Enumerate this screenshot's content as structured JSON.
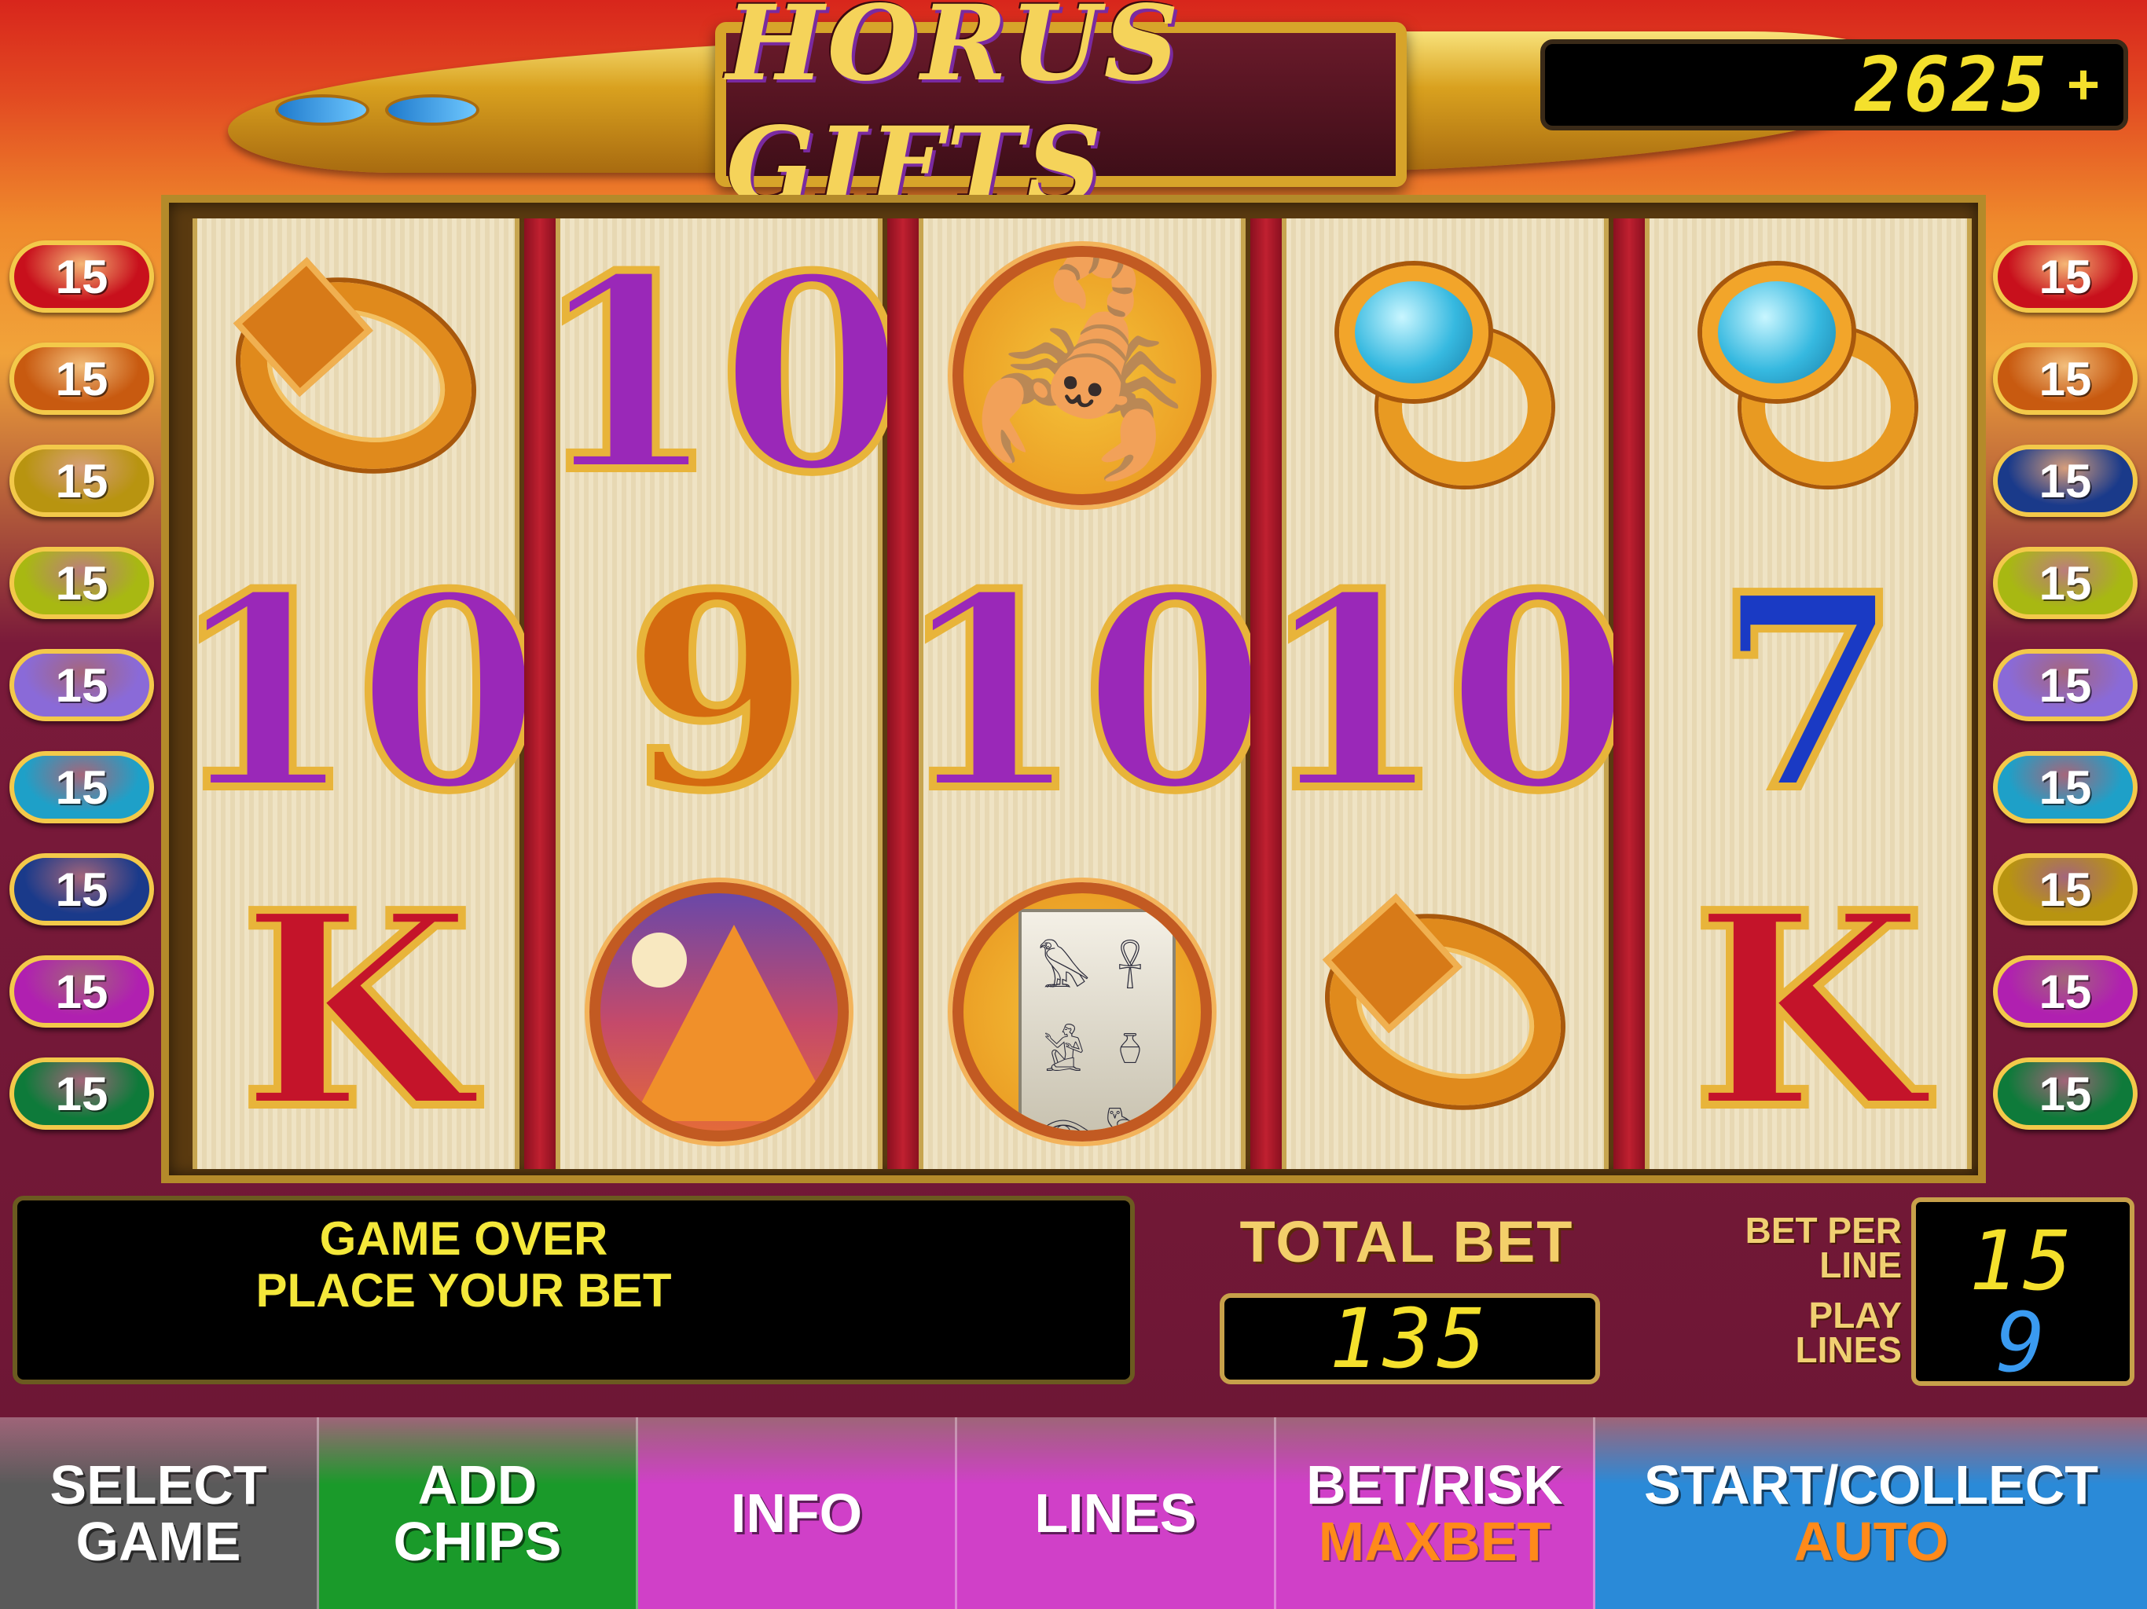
{
  "game": {
    "title": "HORUS GIFTS",
    "credits": "2625",
    "credits_add": "+"
  },
  "reels": [
    [
      "gold-ring",
      "10",
      "K"
    ],
    [
      "10",
      "9",
      "pyramid"
    ],
    [
      "scorpion",
      "10",
      "hieroglyph-tablet"
    ],
    [
      "gem-ring",
      "10",
      "gold-ring"
    ],
    [
      "gem-ring",
      "7",
      "K"
    ]
  ],
  "lines_left": [
    {
      "value": "15",
      "color": "#c8101c"
    },
    {
      "value": "15",
      "color": "#c85a10"
    },
    {
      "value": "15",
      "color": "#b89410"
    },
    {
      "value": "15",
      "color": "#a8b812"
    },
    {
      "value": "15",
      "color": "#8a6ad8"
    },
    {
      "value": "15",
      "color": "#1ea0c8"
    },
    {
      "value": "15",
      "color": "#1a3a8a"
    },
    {
      "value": "15",
      "color": "#b020b0"
    },
    {
      "value": "15",
      "color": "#0e7a3a"
    }
  ],
  "lines_right": [
    {
      "value": "15",
      "color": "#c8101c"
    },
    {
      "value": "15",
      "color": "#c85a10"
    },
    {
      "value": "15",
      "color": "#1a3a8a"
    },
    {
      "value": "15",
      "color": "#a8b812"
    },
    {
      "value": "15",
      "color": "#8a6ad8"
    },
    {
      "value": "15",
      "color": "#1ea0c8"
    },
    {
      "value": "15",
      "color": "#b89410"
    },
    {
      "value": "15",
      "color": "#b020b0"
    },
    {
      "value": "15",
      "color": "#0e7a3a"
    }
  ],
  "message": {
    "line1": "GAME OVER",
    "line2": "PLACE YOUR BET"
  },
  "total_bet": {
    "label": "TOTAL BET",
    "value": "135"
  },
  "bet_per_line": {
    "label_1": "BET PER",
    "label_2": "LINE",
    "value": "15"
  },
  "play_lines": {
    "label_1": "PLAY",
    "label_2": "LINES",
    "value": "9"
  },
  "buttons": [
    {
      "line1": "SELECT",
      "line2": "GAME",
      "sub": "",
      "color": "#5a5a5a"
    },
    {
      "line1": "ADD",
      "line2": "CHIPS",
      "sub": "",
      "color": "#1a9a2a"
    },
    {
      "line1": "INFO",
      "line2": "",
      "sub": "",
      "color": "#d040c8"
    },
    {
      "line1": "LINES",
      "line2": "",
      "sub": "",
      "color": "#d040c8"
    },
    {
      "line1": "BET/RISK",
      "line2": "",
      "sub": "MAXBET",
      "color": "#d040c8"
    },
    {
      "line1": "START/COLLECT",
      "line2": "",
      "sub": "AUTO",
      "color": "#2a8ad8"
    }
  ]
}
